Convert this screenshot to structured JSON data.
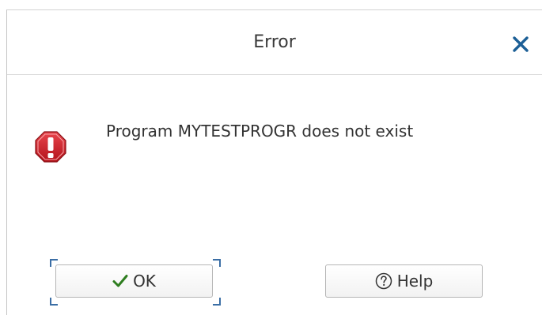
{
  "dialog": {
    "title": "Error",
    "message": "Program MYTESTPROGR does not exist",
    "icons": {
      "close": "close-icon",
      "message": "error-stop-icon",
      "ok": "checkmark-icon",
      "help": "question-circle-icon"
    },
    "colors": {
      "close": "#1c5f96",
      "error_red": "#d0202a",
      "ok_check": "#2e7d1f",
      "focus": "#3b6ea5"
    },
    "buttons": {
      "ok_label": "OK",
      "help_label": "Help"
    }
  }
}
